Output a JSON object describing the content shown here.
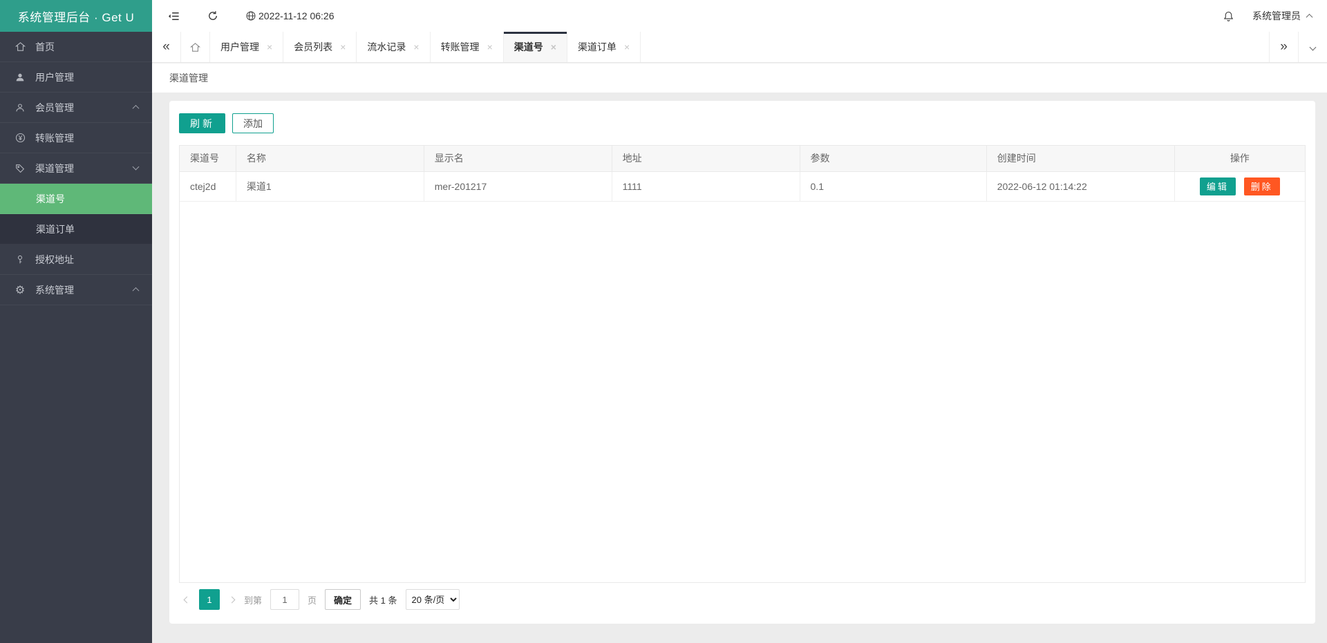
{
  "sidebar": {
    "title": "系统管理后台 · Get U",
    "items": [
      {
        "label": "首页",
        "icon": "home-icon"
      },
      {
        "label": "用户管理",
        "icon": "user-icon"
      },
      {
        "label": "会员管理",
        "icon": "member-icon",
        "chevron": "up"
      },
      {
        "label": "转账管理",
        "icon": "yen-icon"
      },
      {
        "label": "渠道管理",
        "icon": "tag-icon",
        "chevron": "down",
        "children": [
          {
            "label": "渠道号",
            "active": true
          },
          {
            "label": "渠道订单",
            "active": false
          }
        ]
      },
      {
        "label": "授权地址",
        "icon": "key-icon"
      },
      {
        "label": "系统管理",
        "icon": "gear-icon",
        "chevron": "up"
      }
    ]
  },
  "topbar": {
    "datetime": "2022-11-12 06:26",
    "username": "系统管理员"
  },
  "tabbar": {
    "items": [
      {
        "label": "用户管理",
        "active": false
      },
      {
        "label": "会员列表",
        "active": false
      },
      {
        "label": "流水记录",
        "active": false
      },
      {
        "label": "转账管理",
        "active": false
      },
      {
        "label": "渠道号",
        "active": true
      },
      {
        "label": "渠道订单",
        "active": false
      }
    ],
    "close_glyph": "×",
    "collapse_left_glyph": "«",
    "collapse_right_glyph": "»"
  },
  "breadcrumb": {
    "title": "渠道管理"
  },
  "toolbar": {
    "refresh_label": "刷新",
    "add_label": "添加"
  },
  "table": {
    "headers": [
      "渠道号",
      "名称",
      "显示名",
      "地址",
      "参数",
      "创建时间",
      "操作"
    ],
    "rows": [
      {
        "cells": [
          "ctej2d",
          "渠道1",
          "mer-201217",
          "1111",
          "0.1",
          "2022-06-12 01:14:22"
        ]
      }
    ],
    "actions": {
      "edit_label": "编辑",
      "delete_label": "删除"
    }
  },
  "pagination": {
    "current_page": "1",
    "goto_label": "到第",
    "goto_value": "1",
    "page_label": "页",
    "confirm_label": "确定",
    "total_label": "共 1 条",
    "page_size_label": "20 条/页"
  },
  "colors": {
    "brand_header": "#2F9E8B",
    "primary": "#10A08F",
    "danger": "#FF5722",
    "sidebar_bg": "#393D49",
    "sidebar_sub_bg": "#2F323E",
    "sidebar_active": "#5FB878",
    "active_tab_marker": "#2B3240",
    "page_bg": "#ececec"
  }
}
